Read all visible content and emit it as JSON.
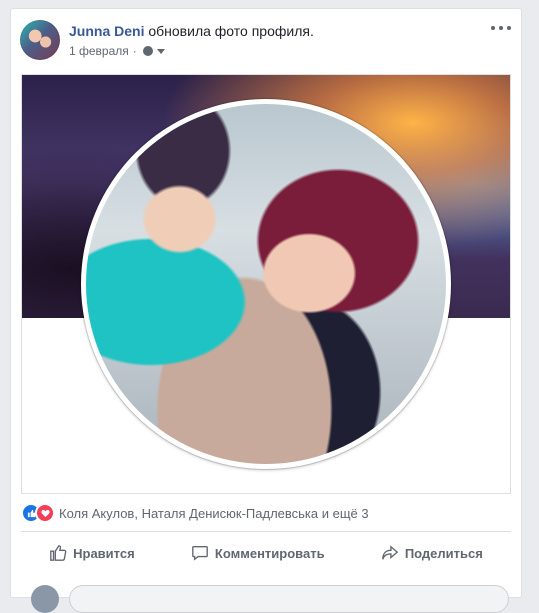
{
  "post": {
    "author": "Junna Deni",
    "action_text": "обновила фото профиля.",
    "date": "1 февраля",
    "separator": "·",
    "privacy_icon": "globe-icon",
    "menu_icon": "more-dots-icon"
  },
  "reactions": {
    "icons": [
      "like-icon",
      "love-icon"
    ],
    "text": "Коля Акулов, Наталя Денисюк-Падлевська и ещё 3"
  },
  "actions": {
    "like": "Нравится",
    "comment": "Комментировать",
    "share": "Поделиться"
  },
  "colors": {
    "link": "#385898",
    "like": "#1b74e4",
    "love": "#f33e58",
    "text_secondary": "#606770"
  }
}
